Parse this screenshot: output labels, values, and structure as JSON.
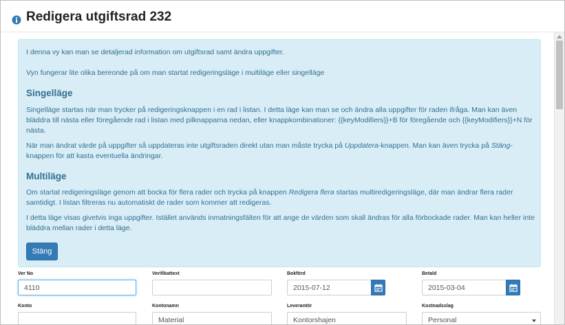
{
  "dialog": {
    "title": "Redigera utgiftsrad 232"
  },
  "help": {
    "intro1": "I denna vy kan man se detaljerad information om utgiftsrad samt ändra uppgifter.",
    "intro2": "Vyn fungerar lite olika bereonde på om man startat redigeringsläge i multiläge eller singelläge",
    "single_heading": "Singelläge",
    "single_p1": "Singelläge startas när man trycker på redigeringsknappen i en rad i listan. I detta läge kan man se och ändra alla uppgifter för raden ifråga. Man kan även bläddra till nästa eller föregående rad i listan med pilknapparna nedan, eller knappkombinationer: {{keyModifiers}}+B för föregående och {{keyModifiers}}+N för nästa.",
    "single_p2_a": "När man ändrat värde på uppgifter så uppdateras inte utgiftsraden direkt utan man måste trycka på ",
    "single_p2_em1": "Uppdatera",
    "single_p2_b": "-knappen. Man kan även trycka på ",
    "single_p2_em2": "Stäng",
    "single_p2_c": "-knappen för att kasta eventuella ändringar.",
    "multi_heading": "Multiläge",
    "multi_p1_a": "Om startat redigeringsläge genom att bocka för flera rader och trycka på knappen ",
    "multi_p1_em": "Redigera flera",
    "multi_p1_b": " startas multiredigeringsläge, där man ändrar flera rader samtidigt. I listan filtreras nu automatiskt de rader som kommer att redigeras.",
    "multi_p2": "I detta läge visas givetvis inga uppgifter. Istället används inmatningsfälten för att ange de värden som skall ändras för alla förbockade rader. Man kan heller inte bläddra mellan rader i detta läge.",
    "close_label": "Stäng"
  },
  "form": {
    "ver_no": {
      "label": "Ver No",
      "value": "4110"
    },
    "verifikattext": {
      "label": "Verifikattext",
      "value": ""
    },
    "bokford": {
      "label": "Bokförd",
      "value": "2015-07-12"
    },
    "betald": {
      "label": "Betald",
      "value": "2015-03-04"
    },
    "konto": {
      "label": "Konto",
      "value": ""
    },
    "kontonamn": {
      "label": "Kontonamn",
      "value": "Material"
    },
    "leverantor": {
      "label": "Leverantör",
      "value": "Kontorshajen"
    },
    "kostnadsslag": {
      "label": "Kostnadsslag",
      "value": "Personal"
    }
  },
  "colors": {
    "primary": "#337ab7",
    "info_bg": "#d9edf7",
    "info_text": "#31708f"
  },
  "icons": {
    "header": "info-circle-icon",
    "date": "calendar-icon",
    "select": "caret-down-icon"
  }
}
